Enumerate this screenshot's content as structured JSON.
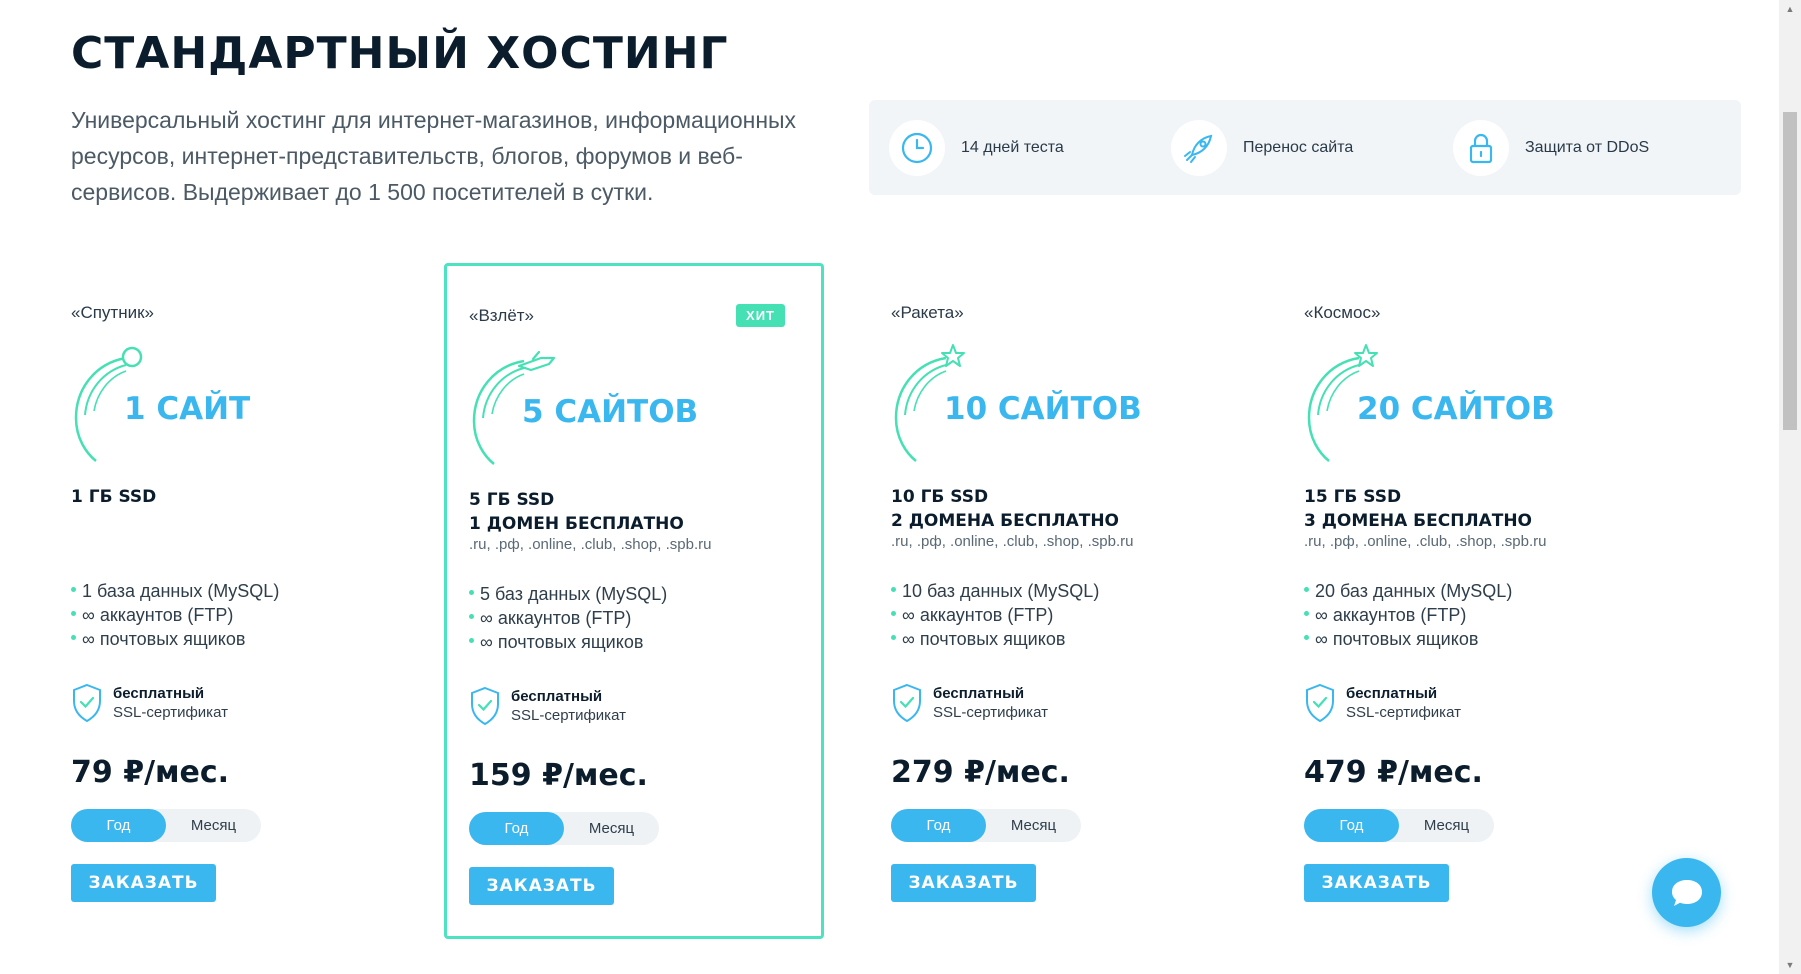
{
  "title": "СТАНДАРТНЫЙ ХОСТИНГ",
  "intro": "Универсальный хостинг для интернет-магазинов, информационных ресурсов, интернет-представительств, блогов, форумов и веб-сервисов. Выдерживает до 1 500 посетителей в сутки.",
  "features": [
    {
      "icon": "clock-icon",
      "label": "14 дней теста"
    },
    {
      "icon": "rocket-icon",
      "label": "Перенос сайта"
    },
    {
      "icon": "lock-icon",
      "label": "Защита от DDoS"
    }
  ],
  "colors": {
    "accent": "#3ab7ef",
    "green": "#45e0b4",
    "dark": "#0b1d2c"
  },
  "plans": [
    {
      "name": "«Спутник»",
      "badge": "",
      "arc_icon": "satellite-icon",
      "sites": "1 САЙТ",
      "ssd": "1 ГБ SSD",
      "domains": "",
      "zones": "",
      "specs": [
        "1 база данных (MySQL)",
        "∞ аккаунтов (FTP)",
        "∞ почтовых ящиков"
      ],
      "ssl_bold": "бесплатный",
      "ssl_text": "SSL-сертификат",
      "price": "79 ₽/мес.",
      "toggle_year": "Год",
      "toggle_month": "Месяц",
      "order": "ЗАКАЗАТЬ"
    },
    {
      "name": "«Взлёт»",
      "badge": "ХИТ",
      "arc_icon": "plane-icon",
      "sites": "5 САЙТОВ",
      "ssd": "5 ГБ SSD",
      "domains": "1 ДОМЕН БЕСПЛАТНО",
      "zones": ".ru, .рф, .online, .club, .shop, .spb.ru",
      "specs": [
        "5 баз данных (MySQL)",
        "∞ аккаунтов (FTP)",
        "∞ почтовых ящиков"
      ],
      "ssl_bold": "бесплатный",
      "ssl_text": "SSL-сертификат",
      "price": "159 ₽/мес.",
      "toggle_year": "Год",
      "toggle_month": "Месяц",
      "order": "ЗАКАЗАТЬ"
    },
    {
      "name": "«Ракета»",
      "badge": "",
      "arc_icon": "star-icon",
      "sites": "10 САЙТОВ",
      "ssd": "10 ГБ SSD",
      "domains": "2 ДОМЕНА БЕСПЛАТНО",
      "zones": ".ru, .рф, .online, .club, .shop, .spb.ru",
      "specs": [
        "10 баз данных (MySQL)",
        "∞ аккаунтов (FTP)",
        "∞ почтовых ящиков"
      ],
      "ssl_bold": "бесплатный",
      "ssl_text": "SSL-сертификат",
      "price": "279 ₽/мес.",
      "toggle_year": "Год",
      "toggle_month": "Месяц",
      "order": "ЗАКАЗАТЬ"
    },
    {
      "name": "«Космос»",
      "badge": "",
      "arc_icon": "star-icon",
      "sites": "20 САЙТОВ",
      "ssd": "15 ГБ SSD",
      "domains": "3 ДОМЕНА БЕСПЛАТНО",
      "zones": ".ru, .рф, .online, .club, .shop, .spb.ru",
      "specs": [
        "20 баз данных (MySQL)",
        "∞ аккаунтов (FTP)",
        "∞ почтовых ящиков"
      ],
      "ssl_bold": "бесплатный",
      "ssl_text": "SSL-сертификат",
      "price": "479 ₽/мес.",
      "toggle_year": "Год",
      "toggle_month": "Месяц",
      "order": "ЗАКАЗАТЬ"
    }
  ]
}
